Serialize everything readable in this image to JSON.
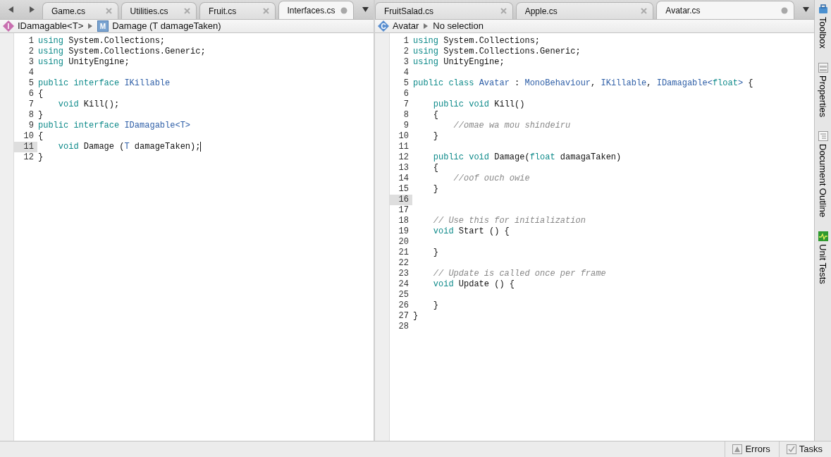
{
  "editors": [
    {
      "history_buttons": true,
      "tabs": [
        {
          "label": "Game.cs",
          "selected": false,
          "modified": false
        },
        {
          "label": "Utilities.cs",
          "selected": false,
          "modified": false
        },
        {
          "label": "Fruit.cs",
          "selected": false,
          "modified": false
        },
        {
          "label": "Interfaces.cs",
          "selected": true,
          "modified": true
        }
      ],
      "breadcrumb": [
        {
          "kind": "interface",
          "letter": "I",
          "label": "IDamagable<T>"
        },
        {
          "kind": "method",
          "letter": "M",
          "label": "Damage (T damageTaken)"
        }
      ],
      "lines": [
        {
          "number": "1",
          "current": false,
          "caret": false,
          "tokens": [
            {
              "kind": "kw",
              "text": "using"
            },
            {
              "kind": "plain",
              "text": " System.Collections;"
            }
          ]
        },
        {
          "number": "2",
          "current": false,
          "caret": false,
          "tokens": [
            {
              "kind": "kw",
              "text": "using"
            },
            {
              "kind": "plain",
              "text": " System.Collections.Generic;"
            }
          ]
        },
        {
          "number": "3",
          "current": false,
          "caret": false,
          "tokens": [
            {
              "kind": "kw",
              "text": "using"
            },
            {
              "kind": "plain",
              "text": " UnityEngine;"
            }
          ]
        },
        {
          "number": "4",
          "current": false,
          "caret": false
        },
        {
          "number": "5",
          "current": false,
          "caret": false,
          "tokens": [
            {
              "kind": "kw",
              "text": "public interface "
            },
            {
              "kind": "type",
              "text": "IKillable"
            }
          ]
        },
        {
          "number": "6",
          "current": false,
          "caret": false,
          "tokens": [
            {
              "kind": "plain",
              "text": "{"
            }
          ]
        },
        {
          "number": "7",
          "current": false,
          "caret": false,
          "tokens": [
            {
              "kind": "kw",
              "text": "    void"
            },
            {
              "kind": "plain",
              "text": " Kill();"
            }
          ]
        },
        {
          "number": "8",
          "current": false,
          "caret": false,
          "tokens": [
            {
              "kind": "plain",
              "text": "}"
            }
          ]
        },
        {
          "number": "9",
          "current": false,
          "caret": false,
          "tokens": [
            {
              "kind": "kw",
              "text": "public interface "
            },
            {
              "kind": "type",
              "text": "IDamagable<T>"
            }
          ]
        },
        {
          "number": "10",
          "current": false,
          "caret": false,
          "tokens": [
            {
              "kind": "plain",
              "text": "{"
            }
          ]
        },
        {
          "number": "11",
          "current": true,
          "caret": true,
          "tokens": [
            {
              "kind": "kw",
              "text": "    void"
            },
            {
              "kind": "plain",
              "text": " Damage ("
            },
            {
              "kind": "type",
              "text": "T"
            },
            {
              "kind": "plain",
              "text": " damageTaken);"
            }
          ]
        },
        {
          "number": "12",
          "current": false,
          "caret": false,
          "tokens": [
            {
              "kind": "plain",
              "text": "}"
            }
          ]
        }
      ]
    },
    {
      "history_buttons": false,
      "tabs": [
        {
          "label": "FruitSalad.cs",
          "selected": false,
          "modified": false
        },
        {
          "label": "Apple.cs",
          "selected": false,
          "modified": false
        },
        {
          "label": "Avatar.cs",
          "selected": true,
          "modified": true
        }
      ],
      "breadcrumb": [
        {
          "kind": "class",
          "letter": "C",
          "label": "Avatar"
        },
        {
          "label": "No selection"
        }
      ],
      "lines": [
        {
          "number": "1",
          "current": false,
          "caret": false,
          "tokens": [
            {
              "kind": "kw",
              "text": "using"
            },
            {
              "kind": "plain",
              "text": " System.Collections;"
            }
          ]
        },
        {
          "number": "2",
          "current": false,
          "caret": false,
          "tokens": [
            {
              "kind": "kw",
              "text": "using"
            },
            {
              "kind": "plain",
              "text": " System.Collections.Generic;"
            }
          ]
        },
        {
          "number": "3",
          "current": false,
          "caret": false,
          "tokens": [
            {
              "kind": "kw",
              "text": "using"
            },
            {
              "kind": "plain",
              "text": " UnityEngine;"
            }
          ]
        },
        {
          "number": "4",
          "current": false,
          "caret": false
        },
        {
          "number": "5",
          "current": false,
          "caret": false,
          "tokens": [
            {
              "kind": "kw",
              "text": "public class "
            },
            {
              "kind": "type",
              "text": "Avatar"
            },
            {
              "kind": "plain",
              "text": " : "
            },
            {
              "kind": "type",
              "text": "MonoBehaviour"
            },
            {
              "kind": "plain",
              "text": ", "
            },
            {
              "kind": "type",
              "text": "IKillable"
            },
            {
              "kind": "plain",
              "text": ", "
            },
            {
              "kind": "type",
              "text": "IDamagable<"
            },
            {
              "kind": "kw",
              "text": "float"
            },
            {
              "kind": "type",
              "text": ">"
            },
            {
              "kind": "plain",
              "text": " {"
            }
          ]
        },
        {
          "number": "6",
          "current": false,
          "caret": false
        },
        {
          "number": "7",
          "current": false,
          "caret": false,
          "tokens": [
            {
              "kind": "kw",
              "text": "    public void"
            },
            {
              "kind": "plain",
              "text": " Kill()"
            }
          ]
        },
        {
          "number": "8",
          "current": false,
          "caret": false,
          "tokens": [
            {
              "kind": "plain",
              "text": "    {"
            }
          ]
        },
        {
          "number": "9",
          "current": false,
          "caret": false,
          "tokens": [
            {
              "kind": "comment",
              "text": "        //omae wa mou shindeiru"
            }
          ]
        },
        {
          "number": "10",
          "current": false,
          "caret": false,
          "tokens": [
            {
              "kind": "plain",
              "text": "    }"
            }
          ]
        },
        {
          "number": "11",
          "current": false,
          "caret": false
        },
        {
          "number": "12",
          "current": false,
          "caret": false,
          "tokens": [
            {
              "kind": "kw",
              "text": "    public void"
            },
            {
              "kind": "plain",
              "text": " Damage("
            },
            {
              "kind": "kw",
              "text": "float"
            },
            {
              "kind": "plain",
              "text": " damagaTaken)"
            }
          ]
        },
        {
          "number": "13",
          "current": false,
          "caret": false,
          "tokens": [
            {
              "kind": "plain",
              "text": "    {"
            }
          ]
        },
        {
          "number": "14",
          "current": false,
          "caret": false,
          "tokens": [
            {
              "kind": "comment",
              "text": "        //oof ouch owie"
            }
          ]
        },
        {
          "number": "15",
          "current": false,
          "caret": false,
          "tokens": [
            {
              "kind": "plain",
              "text": "    }"
            }
          ]
        },
        {
          "number": "16",
          "current": true,
          "caret": false
        },
        {
          "number": "17",
          "current": false,
          "caret": false
        },
        {
          "number": "18",
          "current": false,
          "caret": false,
          "tokens": [
            {
              "kind": "comment",
              "text": "    // Use this for initialization"
            }
          ]
        },
        {
          "number": "19",
          "current": false,
          "caret": false,
          "tokens": [
            {
              "kind": "kw",
              "text": "    void"
            },
            {
              "kind": "plain",
              "text": " Start () {"
            }
          ]
        },
        {
          "number": "20",
          "current": false,
          "caret": false
        },
        {
          "number": "21",
          "current": false,
          "caret": false,
          "tokens": [
            {
              "kind": "plain",
              "text": "    }"
            }
          ]
        },
        {
          "number": "22",
          "current": false,
          "caret": false
        },
        {
          "number": "23",
          "current": false,
          "caret": false,
          "tokens": [
            {
              "kind": "comment",
              "text": "    // Update is called once per frame"
            }
          ]
        },
        {
          "number": "24",
          "current": false,
          "caret": false,
          "tokens": [
            {
              "kind": "kw",
              "text": "    void"
            },
            {
              "kind": "plain",
              "text": " Update () {"
            }
          ]
        },
        {
          "number": "25",
          "current": false,
          "caret": false
        },
        {
          "number": "26",
          "current": false,
          "caret": false,
          "tokens": [
            {
              "kind": "plain",
              "text": "    }"
            }
          ]
        },
        {
          "number": "27",
          "current": false,
          "caret": false,
          "tokens": [
            {
              "kind": "plain",
              "text": "}"
            }
          ]
        },
        {
          "number": "28",
          "current": false,
          "caret": false
        }
      ]
    }
  ],
  "side_pads": [
    {
      "kind": "toolbox",
      "label": "Toolbox"
    },
    {
      "kind": "properties",
      "label": "Properties"
    },
    {
      "kind": "outline",
      "label": "Document Outline"
    },
    {
      "kind": "tests",
      "label": "Unit Tests"
    }
  ],
  "status_bar": [
    {
      "kind": "warning",
      "label": "Errors"
    },
    {
      "kind": "check",
      "label": "Tasks"
    }
  ]
}
